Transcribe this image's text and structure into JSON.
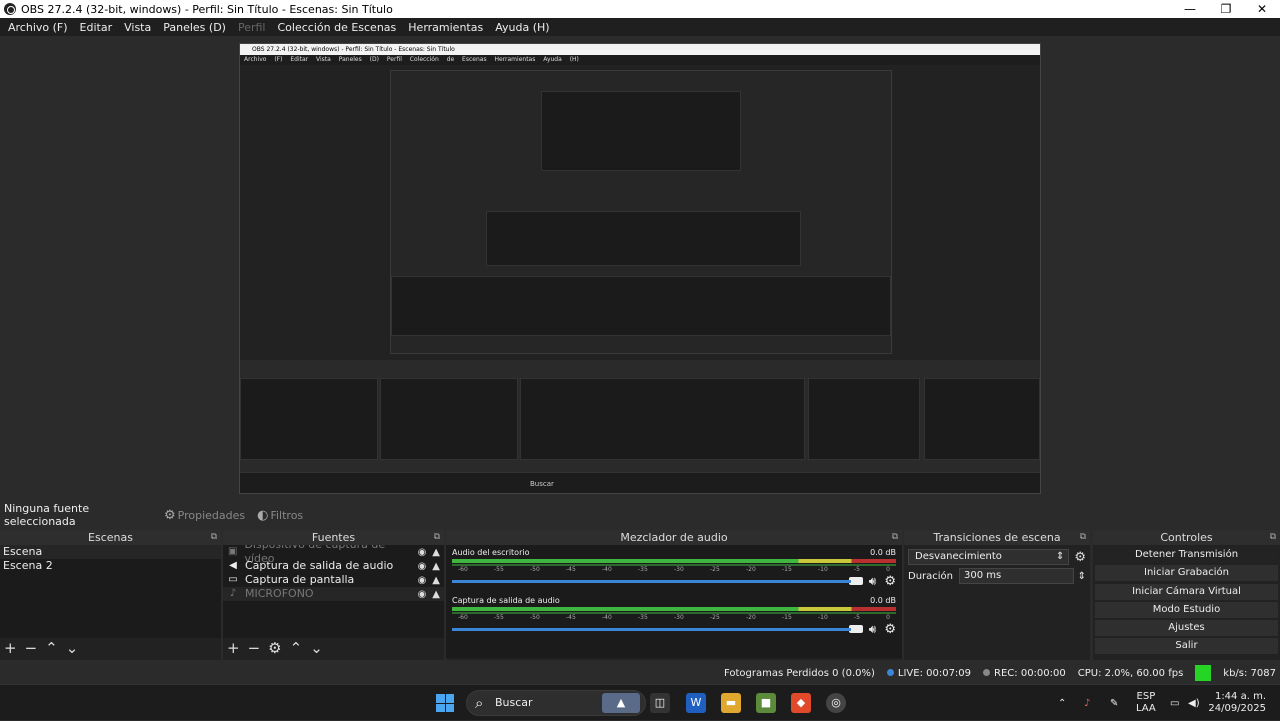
{
  "window": {
    "title": "OBS 27.2.4 (32-bit, windows) - Perfil: Sin Título - Escenas: Sin Título"
  },
  "menu": {
    "items": [
      "Archivo (F)",
      "Editar",
      "Vista",
      "Paneles (D)",
      "Perfil",
      "Colección de Escenas",
      "Herramientas",
      "Ayuda (H)"
    ]
  },
  "nested": {
    "title": "OBS 27.2.4 (32-bit, windows) - Perfil: Sin Título - Escenas: Sin Título",
    "menu": "Archivo (F)  Editar  Vista  Paneles (D)  Perfil  Colección de Escenas  Herramientas  Ayuda (H)",
    "taskbar": "Buscar"
  },
  "source_bar": {
    "no_source": "Ninguna fuente seleccionada",
    "properties": "Propiedades",
    "filters": "Filtros"
  },
  "scenes": {
    "title": "Escenas",
    "items": [
      "Escena",
      "Escena 2"
    ]
  },
  "sources": {
    "title": "Fuentes",
    "items": [
      "Dispositivo de captura de vídeo",
      "Captura de salida de audio",
      "Captura de pantalla",
      "MICROFONO"
    ]
  },
  "mixer": {
    "title": "Mezclador de audio",
    "tracks": [
      {
        "name": "Audio del escritorio",
        "db": "0.0 dB"
      },
      {
        "name": "Captura de salida de audio",
        "db": "0.0 dB"
      }
    ],
    "ticks": [
      "-60",
      "-55",
      "-50",
      "-45",
      "-40",
      "-35",
      "-30",
      "-25",
      "-20",
      "-15",
      "-10",
      "-5",
      "0"
    ]
  },
  "transitions": {
    "title": "Transiciones de escena",
    "type": "Desvanecimiento",
    "duration_label": "Duración",
    "duration": "300 ms"
  },
  "controls": {
    "title": "Controles",
    "buttons": [
      "Detener Transmisión",
      "Iniciar Grabación",
      "Iniciar Cámara Virtual",
      "Modo Estudio",
      "Ajustes",
      "Salir"
    ]
  },
  "status": {
    "dropped": "Fotogramas Perdidos 0 (0.0%)",
    "live": "LIVE: 00:07:09",
    "rec": "REC: 00:00:00",
    "cpu": "CPU: 2.0%, 60.00 fps",
    "kbps": "kb/s: 7087"
  },
  "taskbar": {
    "search": "Buscar",
    "lang1": "ESP",
    "lang2": "LAA",
    "time": "1:44 a. m.",
    "date": "24/09/2025"
  },
  "colors": {
    "accent": "#3b86d9",
    "live_green": "#26d426"
  }
}
